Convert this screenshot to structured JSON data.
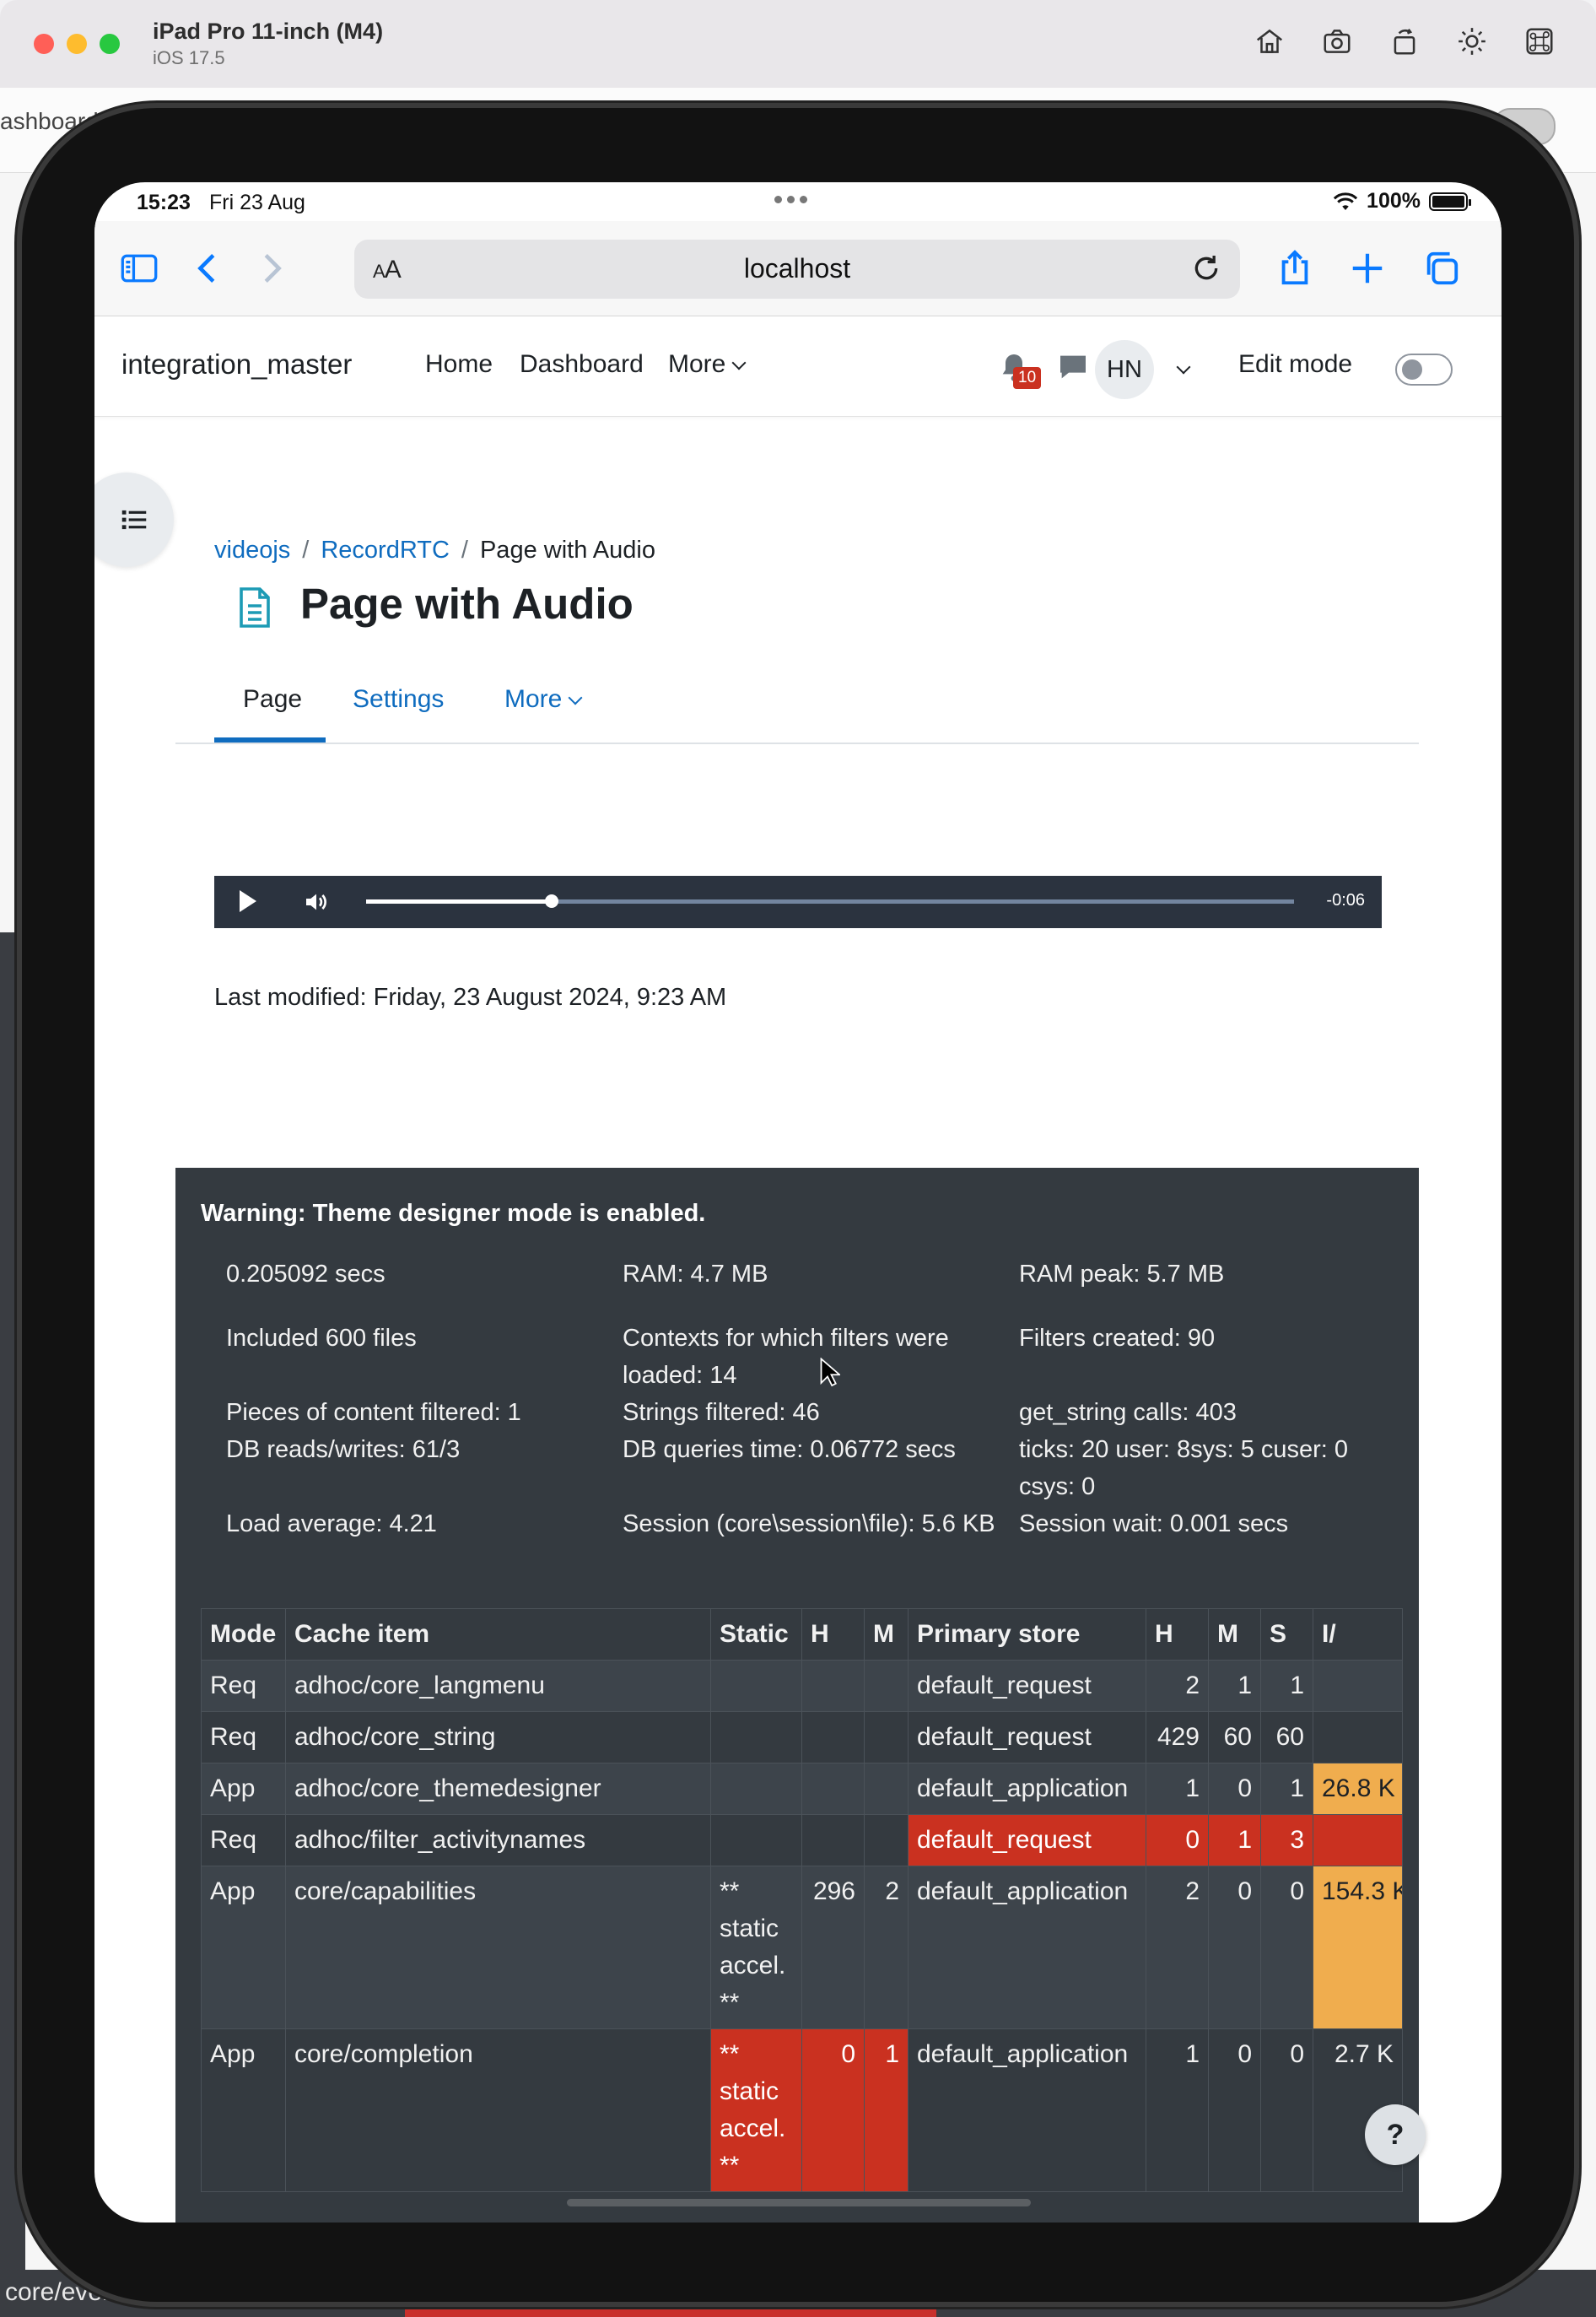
{
  "simulator": {
    "device_name": "iPad Pro 11-inch (M4)",
    "os_version": "iOS 17.5",
    "toolbar_icons": [
      "home-icon",
      "screenshot-icon",
      "rotate-icon",
      "appearance-icon",
      "command-icon"
    ]
  },
  "background": {
    "fragment_top": "ashboard",
    "fragment_bottom": "core/eventinvalidation"
  },
  "status_bar": {
    "time": "15:23",
    "date": "Fri 23 Aug",
    "battery": "100%"
  },
  "safari": {
    "aa_label_big": "A",
    "aa_label_small": "A",
    "url": "localhost"
  },
  "moodle_nav": {
    "site_name": "integration_master",
    "links": {
      "home": "Home",
      "dashboard": "Dashboard",
      "more": "More"
    },
    "notification_count": "10",
    "user_initials": "HN",
    "edit_mode_label": "Edit mode"
  },
  "breadcrumb": {
    "items": [
      "videojs",
      "RecordRTC",
      "Page with Audio"
    ],
    "separator": "/"
  },
  "page": {
    "title": "Page with Audio",
    "tabs": {
      "page": "Page",
      "settings": "Settings",
      "more": "More"
    },
    "last_modified": "Last modified: Friday, 23 August 2024, 9:23 AM"
  },
  "audio_player": {
    "remaining_time": "-0:06",
    "progress": 0.2
  },
  "perf": {
    "warning": "Warning: Theme designer mode is enabled.",
    "cells": {
      "time": "0.205092 secs",
      "ram": "RAM: 4.7 MB",
      "ram_peak": "RAM peak: 5.7 MB",
      "included_files": "Included 600 files",
      "contexts": "Contexts for which filters were loaded: 14",
      "filters_created": "Filters created: 90",
      "content_filtered": "Pieces of content filtered: 1",
      "strings_filtered": "Strings filtered: 46",
      "get_string": "get_string calls: 403",
      "db_rw": "DB reads/writes: 61/3",
      "db_time": "DB queries time: 0.06772 secs",
      "ticks": "ticks: 20 user: 8sys: 5 cuser: 0 csys: 0",
      "load_avg": "Load average: 4.21",
      "session": "Session (core\\session\\file): 5.6 KB",
      "session_wait": "Session wait: 0.001 secs"
    },
    "table": {
      "headers": {
        "mode": "Mode",
        "item": "Cache item",
        "static": "Static",
        "h1": "H",
        "m1": "M",
        "store": "Primary store",
        "h2": "H",
        "m2": "M",
        "s": "S",
        "extra": "I/"
      },
      "rows": [
        {
          "mode": "Req",
          "item": "adhoc/core_langmenu",
          "static": "",
          "h1": "",
          "m1": "",
          "store": "default_request",
          "h2": "2",
          "m2": "1",
          "s": "1",
          "extra": ""
        },
        {
          "mode": "Req",
          "item": "adhoc/core_string",
          "static": "",
          "h1": "",
          "m1": "",
          "store": "default_request",
          "h2": "429",
          "m2": "60",
          "s": "60",
          "extra": ""
        },
        {
          "mode": "App",
          "item": "adhoc/core_themedesigner",
          "static": "",
          "h1": "",
          "m1": "",
          "store": "default_application",
          "h2": "1",
          "m2": "0",
          "s": "1",
          "extra": "26.8 K"
        },
        {
          "mode": "Req",
          "item": "adhoc/filter_activitynames",
          "static": "",
          "h1": "",
          "m1": "",
          "store": "default_request",
          "h2": "0",
          "m2": "1",
          "s": "3",
          "extra": ""
        },
        {
          "mode": "App",
          "item": "core/capabilities",
          "static": "** static accel. **",
          "h1": "296",
          "m1": "2",
          "store": "default_application",
          "h2": "2",
          "m2": "0",
          "s": "0",
          "extra": "154.3 K"
        },
        {
          "mode": "App",
          "item": "core/completion",
          "static": "** static accel. **",
          "h1": "0",
          "m1": "1",
          "store": "default_application",
          "h2": "1",
          "m2": "0",
          "s": "0",
          "extra": "2.7 K"
        }
      ]
    }
  },
  "help_button": "?"
}
